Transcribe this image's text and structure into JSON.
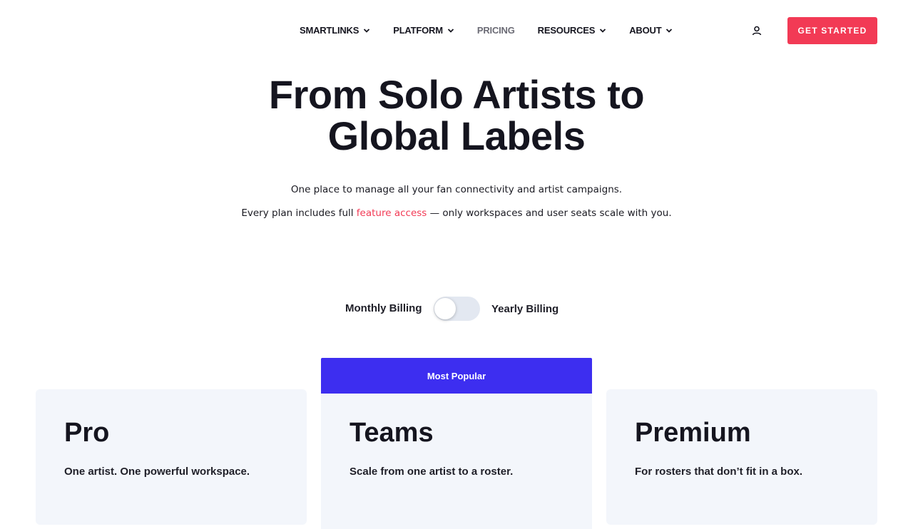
{
  "nav": {
    "items": [
      {
        "label": "SMARTLINKS",
        "has_dropdown": true
      },
      {
        "label": "PLATFORM",
        "has_dropdown": true
      },
      {
        "label": "PRICING",
        "has_dropdown": false,
        "active": true
      },
      {
        "label": "RESOURCES",
        "has_dropdown": true
      },
      {
        "label": "ABOUT",
        "has_dropdown": true
      }
    ],
    "account_icon": "user-icon",
    "cta_label": "GET STARTED"
  },
  "hero": {
    "title_line1": "From Solo Artists to",
    "title_line2": "Global Labels",
    "subtitle": "One place to manage all your fan connectivity and artist campaigns.",
    "subtitle2_before": "Every plan includes full ",
    "subtitle2_link": "feature access",
    "subtitle2_after": " — only workspaces and user seats scale with you."
  },
  "billing": {
    "monthly_label": "Monthly Billing",
    "yearly_label": "Yearly Billing",
    "yearly_selected": false
  },
  "plans": [
    {
      "name": "Pro",
      "tagline": "One artist. One powerful workspace.",
      "badge": ""
    },
    {
      "name": "Teams",
      "tagline": "Scale from one artist to a roster.",
      "badge": "Most Popular"
    },
    {
      "name": "Premium",
      "tagline": "For rosters that don’t fit in a box.",
      "badge": ""
    }
  ],
  "colors": {
    "accent": "#f23a55",
    "popular": "#3d2ef0",
    "card_bg": "#f3f6fb",
    "text": "#15151f"
  }
}
